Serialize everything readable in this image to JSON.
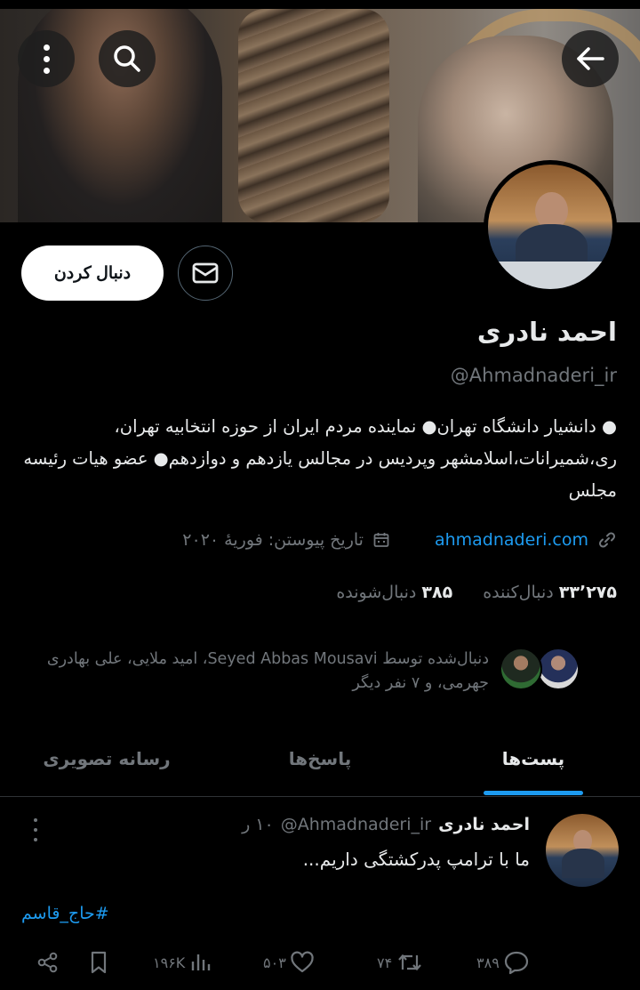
{
  "profile": {
    "name": "احمد نادری",
    "handle": "@Ahmadnaderi_ir",
    "bio": "● دانشیار دانشگاه تهران● نماینده مردم ایران از حوزه انتخابیه تهران، ری،شمیرانات،اسلامشهر وپردیس در مجالس یازدهم و دوازدهم● عضو هیات رئیسه مجلس",
    "website": "ahmadnaderi.com",
    "joined": "تاریخ پیوستن: فوریهٔ ۲۰۲۰",
    "following_count": "۳۸۵",
    "following_label": "دنبال‌شونده",
    "followers_count": "۳۳٬۲۷۵",
    "followers_label": "دنبال‌کننده",
    "followed_by": "دنبال‌شده توسط Seyed Abbas Mousavi، امید ملایی، علی بهادری جهرمی، و ۷ نفر دیگر"
  },
  "buttons": {
    "follow_label": "دنبال کردن"
  },
  "tabs": [
    {
      "label": "پست‌ها",
      "active": true
    },
    {
      "label": "پاسخ‌ها",
      "active": false
    },
    {
      "label": "رسانه تصویری",
      "active": false
    }
  ],
  "post": {
    "author_name": "احمد نادری",
    "author_handle": "@Ahmadnaderi_ir",
    "time": "۱۰ ر",
    "text": "ما با ترامپ پدرکشتگی داریم...",
    "hashtag": "#حاج_قاسم",
    "replies": "۳۸۹",
    "reposts": "۷۴",
    "likes": "۵۰۳",
    "views": "۱۹۶K"
  },
  "icons": {
    "back": "arrow-left-icon",
    "search": "search-icon",
    "more": "more-vertical-icon",
    "message": "envelope-icon",
    "link": "link-icon",
    "calendar": "calendar-icon"
  },
  "colors": {
    "accent": "#1d9bf0",
    "background": "#000000",
    "muted": "#71767b",
    "text": "#e7e9ea"
  }
}
